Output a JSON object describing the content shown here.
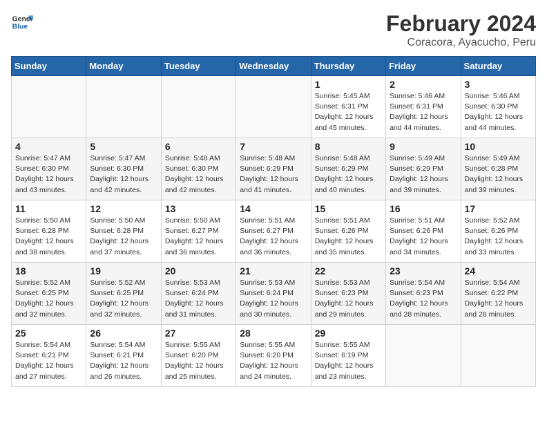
{
  "header": {
    "logo_general": "General",
    "logo_blue": "Blue",
    "title": "February 2024",
    "subtitle": "Coracora, Ayacucho, Peru"
  },
  "weekdays": [
    "Sunday",
    "Monday",
    "Tuesday",
    "Wednesday",
    "Thursday",
    "Friday",
    "Saturday"
  ],
  "weeks": [
    [
      {
        "day": "",
        "info": ""
      },
      {
        "day": "",
        "info": ""
      },
      {
        "day": "",
        "info": ""
      },
      {
        "day": "",
        "info": ""
      },
      {
        "day": "1",
        "info": "Sunrise: 5:45 AM\nSunset: 6:31 PM\nDaylight: 12 hours\nand 45 minutes."
      },
      {
        "day": "2",
        "info": "Sunrise: 5:46 AM\nSunset: 6:31 PM\nDaylight: 12 hours\nand 44 minutes."
      },
      {
        "day": "3",
        "info": "Sunrise: 5:46 AM\nSunset: 6:30 PM\nDaylight: 12 hours\nand 44 minutes."
      }
    ],
    [
      {
        "day": "4",
        "info": "Sunrise: 5:47 AM\nSunset: 6:30 PM\nDaylight: 12 hours\nand 43 minutes."
      },
      {
        "day": "5",
        "info": "Sunrise: 5:47 AM\nSunset: 6:30 PM\nDaylight: 12 hours\nand 42 minutes."
      },
      {
        "day": "6",
        "info": "Sunrise: 5:48 AM\nSunset: 6:30 PM\nDaylight: 12 hours\nand 42 minutes."
      },
      {
        "day": "7",
        "info": "Sunrise: 5:48 AM\nSunset: 6:29 PM\nDaylight: 12 hours\nand 41 minutes."
      },
      {
        "day": "8",
        "info": "Sunrise: 5:48 AM\nSunset: 6:29 PM\nDaylight: 12 hours\nand 40 minutes."
      },
      {
        "day": "9",
        "info": "Sunrise: 5:49 AM\nSunset: 6:29 PM\nDaylight: 12 hours\nand 39 minutes."
      },
      {
        "day": "10",
        "info": "Sunrise: 5:49 AM\nSunset: 6:28 PM\nDaylight: 12 hours\nand 39 minutes."
      }
    ],
    [
      {
        "day": "11",
        "info": "Sunrise: 5:50 AM\nSunset: 6:28 PM\nDaylight: 12 hours\nand 38 minutes."
      },
      {
        "day": "12",
        "info": "Sunrise: 5:50 AM\nSunset: 6:28 PM\nDaylight: 12 hours\nand 37 minutes."
      },
      {
        "day": "13",
        "info": "Sunrise: 5:50 AM\nSunset: 6:27 PM\nDaylight: 12 hours\nand 36 minutes."
      },
      {
        "day": "14",
        "info": "Sunrise: 5:51 AM\nSunset: 6:27 PM\nDaylight: 12 hours\nand 36 minutes."
      },
      {
        "day": "15",
        "info": "Sunrise: 5:51 AM\nSunset: 6:26 PM\nDaylight: 12 hours\nand 35 minutes."
      },
      {
        "day": "16",
        "info": "Sunrise: 5:51 AM\nSunset: 6:26 PM\nDaylight: 12 hours\nand 34 minutes."
      },
      {
        "day": "17",
        "info": "Sunrise: 5:52 AM\nSunset: 6:26 PM\nDaylight: 12 hours\nand 33 minutes."
      }
    ],
    [
      {
        "day": "18",
        "info": "Sunrise: 5:52 AM\nSunset: 6:25 PM\nDaylight: 12 hours\nand 32 minutes."
      },
      {
        "day": "19",
        "info": "Sunrise: 5:52 AM\nSunset: 6:25 PM\nDaylight: 12 hours\nand 32 minutes."
      },
      {
        "day": "20",
        "info": "Sunrise: 5:53 AM\nSunset: 6:24 PM\nDaylight: 12 hours\nand 31 minutes."
      },
      {
        "day": "21",
        "info": "Sunrise: 5:53 AM\nSunset: 6:24 PM\nDaylight: 12 hours\nand 30 minutes."
      },
      {
        "day": "22",
        "info": "Sunrise: 5:53 AM\nSunset: 6:23 PM\nDaylight: 12 hours\nand 29 minutes."
      },
      {
        "day": "23",
        "info": "Sunrise: 5:54 AM\nSunset: 6:23 PM\nDaylight: 12 hours\nand 28 minutes."
      },
      {
        "day": "24",
        "info": "Sunrise: 5:54 AM\nSunset: 6:22 PM\nDaylight: 12 hours\nand 28 minutes."
      }
    ],
    [
      {
        "day": "25",
        "info": "Sunrise: 5:54 AM\nSunset: 6:21 PM\nDaylight: 12 hours\nand 27 minutes."
      },
      {
        "day": "26",
        "info": "Sunrise: 5:54 AM\nSunset: 6:21 PM\nDaylight: 12 hours\nand 26 minutes."
      },
      {
        "day": "27",
        "info": "Sunrise: 5:55 AM\nSunset: 6:20 PM\nDaylight: 12 hours\nand 25 minutes."
      },
      {
        "day": "28",
        "info": "Sunrise: 5:55 AM\nSunset: 6:20 PM\nDaylight: 12 hours\nand 24 minutes."
      },
      {
        "day": "29",
        "info": "Sunrise: 5:55 AM\nSunset: 6:19 PM\nDaylight: 12 hours\nand 23 minutes."
      },
      {
        "day": "",
        "info": ""
      },
      {
        "day": "",
        "info": ""
      }
    ]
  ]
}
